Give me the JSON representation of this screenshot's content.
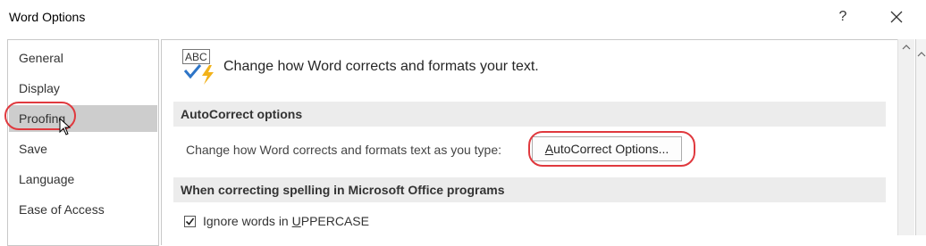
{
  "window": {
    "title": "Word Options",
    "help_label": "?",
    "close_label": "✕"
  },
  "sidebar": {
    "items": [
      {
        "label": "General"
      },
      {
        "label": "Display"
      },
      {
        "label": "Proofing",
        "selected": true
      },
      {
        "label": "Save"
      },
      {
        "label": "Language"
      },
      {
        "label": "Ease of Access"
      }
    ]
  },
  "main": {
    "header_icon": "abc-autocorrect-icon",
    "header_text": "Change how Word corrects and formats your text.",
    "autocorrect_section": {
      "title": "AutoCorrect options",
      "description": "Change how Word corrects and formats text as you type:",
      "button_prefix": "A",
      "button_rest": "utoCorrect Options..."
    },
    "spelling_section": {
      "title": "When correcting spelling in Microsoft Office programs",
      "options": [
        {
          "label_prefix": "Ignore words in ",
          "label_underlined": "U",
          "label_rest": "PPERCASE",
          "checked": true
        }
      ]
    }
  },
  "colors": {
    "highlight": "#e0393e",
    "selected_bg": "#cdcdcd",
    "section_bg": "#ececec"
  }
}
